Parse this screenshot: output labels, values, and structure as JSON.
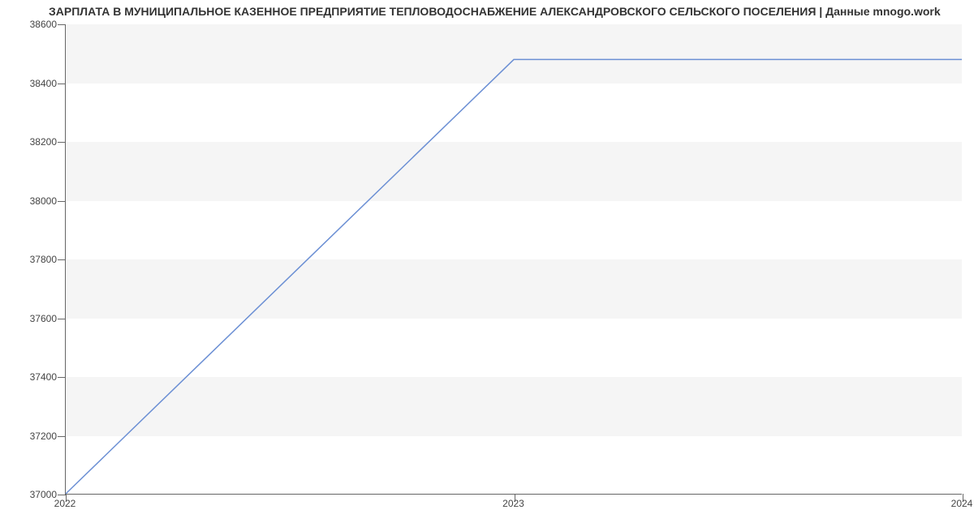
{
  "chart_data": {
    "type": "line",
    "title": "ЗАРПЛАТА В МУНИЦИПАЛЬНОЕ КАЗЕННОЕ ПРЕДПРИЯТИЕ ТЕПЛОВОДОСНАБЖЕНИЕ АЛЕКСАНДРОВСКОГО СЕЛЬСКОГО ПОСЕЛЕНИЯ | Данные mnogo.work",
    "x": [
      2022,
      2023,
      2024
    ],
    "values": [
      37000,
      38480,
      38480
    ],
    "xlabel": "",
    "ylabel": "",
    "ylim": [
      37000,
      38600
    ],
    "xlim": [
      2022,
      2024
    ],
    "y_ticks": [
      37000,
      37200,
      37400,
      37600,
      37800,
      38000,
      38200,
      38400,
      38600
    ],
    "x_ticks": [
      2022,
      2023,
      2024
    ]
  }
}
